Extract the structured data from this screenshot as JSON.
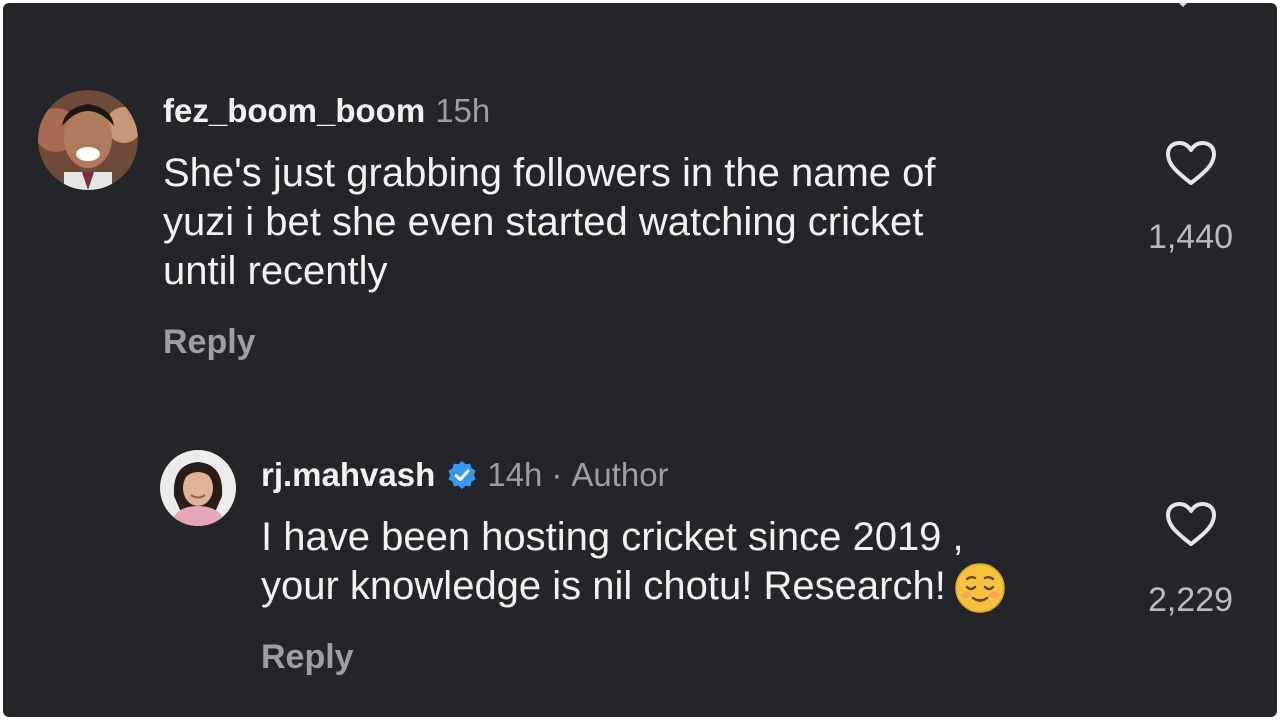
{
  "comments": [
    {
      "username": "fez_boom_boom",
      "time": "15h",
      "lines": [
        "She's just grabbing followers in the name of",
        "yuzi i bet she even started watching cricket",
        "until recently"
      ],
      "reply_label": "Reply",
      "like_count": "1,440",
      "avatar_icon": "profile-photo-man",
      "like_icon": "heart-outline-icon"
    },
    {
      "username": "rj.mahvash",
      "verified": true,
      "time": "14h",
      "separator": "·",
      "author_tag": "Author",
      "lines": [
        "I have been hosting cricket since 2019 ,",
        "your knowledge is nil chotu! Research!"
      ],
      "emoji_icon": "relieved-face-emoji",
      "reply_label": "Reply",
      "like_count": "2,229",
      "avatar_icon": "profile-photo-woman",
      "like_icon": "heart-outline-icon"
    }
  ],
  "colors": {
    "background": "#232529",
    "text_primary": "#f2f2f2",
    "text_secondary": "#9a9ea5",
    "verified_badge": "#3897f0"
  }
}
